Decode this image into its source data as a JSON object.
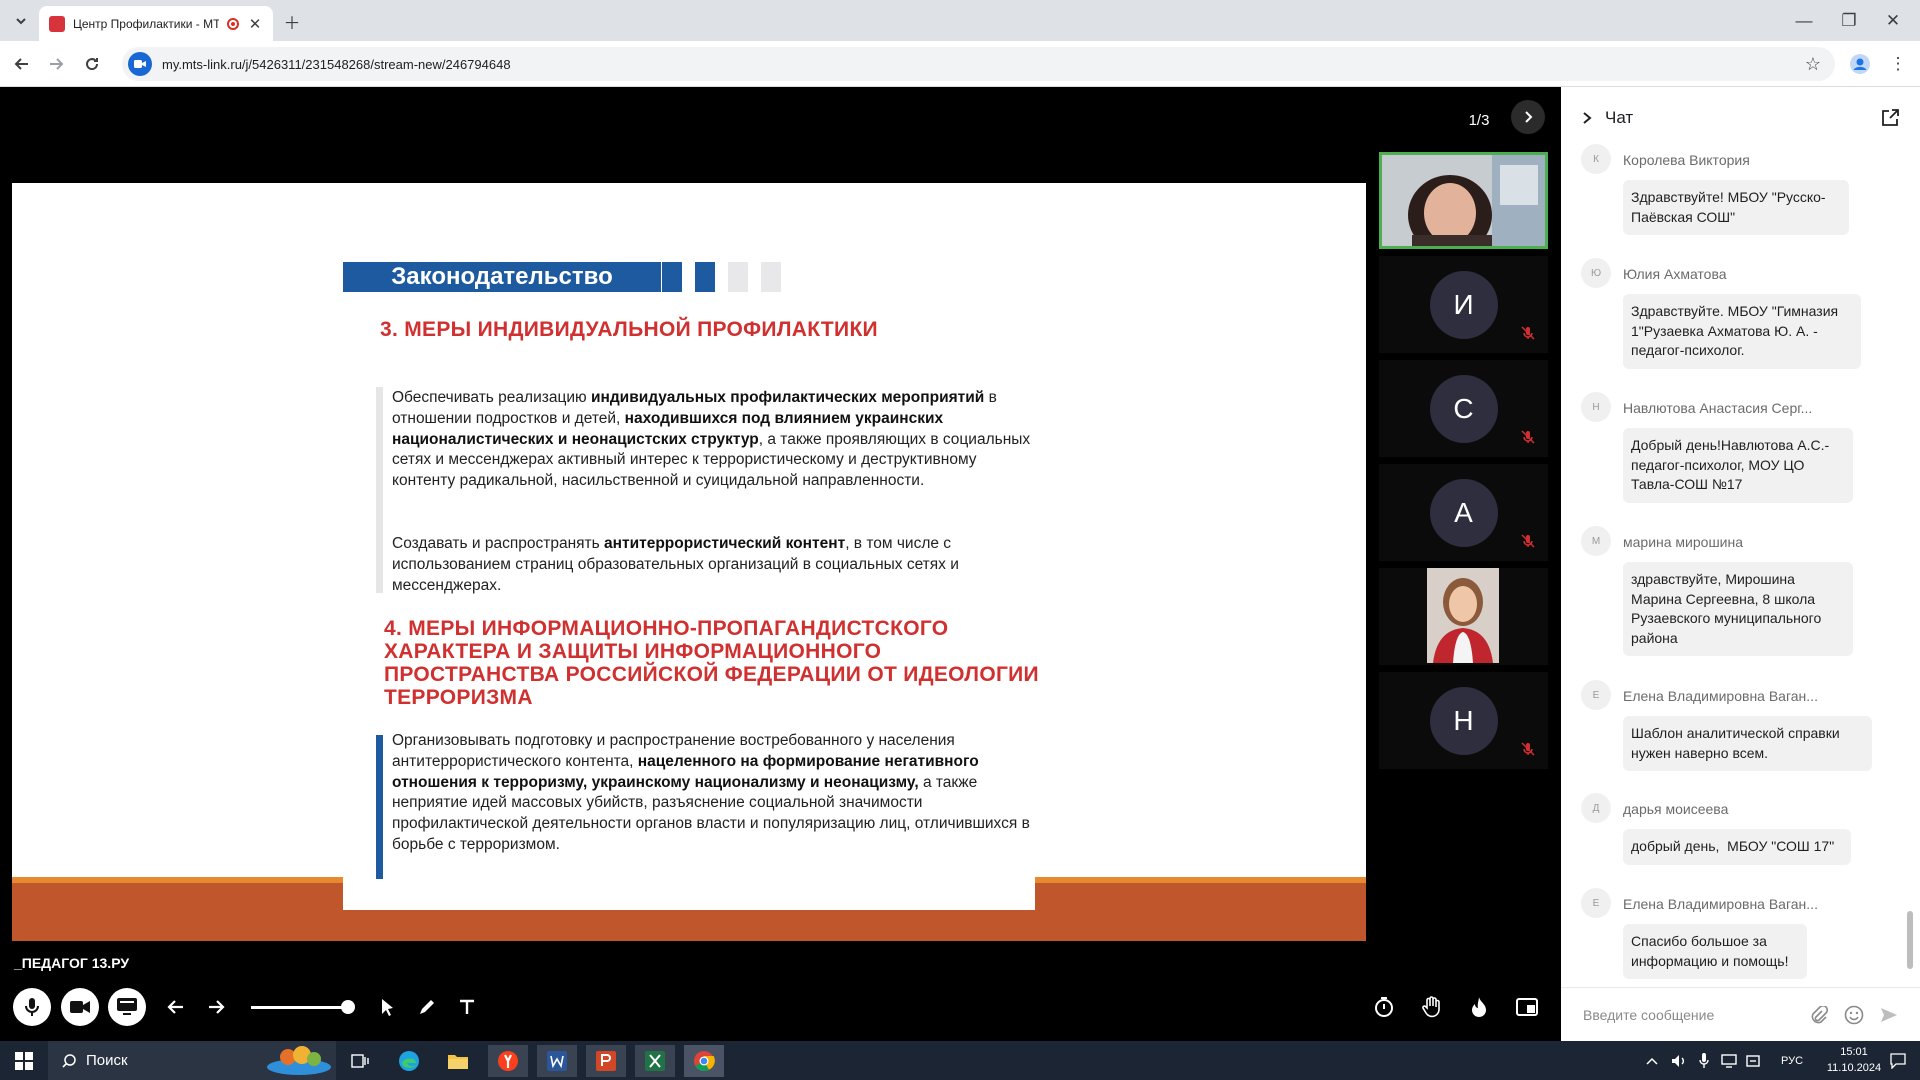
{
  "browser": {
    "tab_title": "Центр Профилактики - МТ",
    "url": "my.mts-link.ru/j/5426311/231548268/stream-new/246794648"
  },
  "stage": {
    "pager": "1/3",
    "brand": "_ПЕДАГОГ 13.РУ"
  },
  "slide": {
    "header": "Законодательство",
    "section3_title": "3. МЕРЫ ИНДИВИДУАЛЬНОЙ ПРОФИЛАКТИКИ",
    "section3_para1": [
      {
        "text": "Обеспечивать реализацию ",
        "bold": false
      },
      {
        "text": "индивидуальных профилактических мероприятий",
        "bold": true
      },
      {
        "text": " в отношении подростков и детей, ",
        "bold": false
      },
      {
        "text": "находившихся под влиянием украинских националистических и неонацистских структур",
        "bold": true
      },
      {
        "text": ", а также проявляющих в социальных сетях и мессенджерах активный интерес к террористическому и деструктивному контенту радикальной, насильственной и суицидальной направленности.",
        "bold": false
      }
    ],
    "section3_para2": [
      {
        "text": "Создавать и распространять ",
        "bold": false
      },
      {
        "text": "антитеррористический контент",
        "bold": true
      },
      {
        "text": ", в том числе с использованием страниц образовательных организаций в социальных сетях и мессенджерах.",
        "bold": false
      }
    ],
    "section4_title": "4. МЕРЫ ИНФОРМАЦИОННО-ПРОПАГАНДИСТСКОГО ХАРАКТЕРА И ЗАЩИТЫ ИНФОРМАЦИОННОГО ПРОСТРАНСТВА РОССИЙСКОЙ ФЕДЕРАЦИИ ОТ ИДЕОЛОГИИ ТЕРРОРИЗМА",
    "section4_para": [
      {
        "text": "Организовывать подготовку и распространение востребованного у населения антитеррористического контента, ",
        "bold": false
      },
      {
        "text": "нацеленного на формирование негативного отношения к терроризму, украинскому национализму и неонацизму,",
        "bold": true
      },
      {
        "text": " а также неприятие идей массовых убийств, разъяснение социальной значимости профилактической деятельности органов власти и популяризацию лиц, отличившихся в борьбе с терроризмом.",
        "bold": false
      }
    ]
  },
  "participants": [
    {
      "type": "video"
    },
    {
      "initial": "И",
      "muted": true
    },
    {
      "initial": "С",
      "muted": true
    },
    {
      "initial": "А",
      "muted": true
    },
    {
      "type": "video"
    },
    {
      "initial": "Н",
      "muted": true
    }
  ],
  "chat": {
    "title": "Чат",
    "input_placeholder": "Введите сообщение",
    "messages": [
      {
        "avatar": "К",
        "name": "Королева Виктория",
        "text": "Здравствуйте! МБОУ \"Русско-Паёвская СОШ\""
      },
      {
        "avatar": "Ю",
        "name": "Юлия Ахматова",
        "text": "Здравствуйте. МБОУ \"Гимназия 1\"Рузаевка Ахматова Ю. А. - педагог-психолог."
      },
      {
        "avatar": "Н",
        "name": "Навлютова Анастасия Серг...",
        "text": "Добрый день!Навлютова А.С.- педагог-психолог, МОУ ЦО Тавла-СОШ №17"
      },
      {
        "avatar": "М",
        "name": "марина мирошина",
        "text": "здравствуйте, Мирошина Марина Сергеевна, 8 школа Рузаевского муниципального района"
      },
      {
        "avatar": "Е",
        "name": "Елена Владимировна Ваган...",
        "text": "Шаблон аналитической справки нужен наверно всем."
      },
      {
        "avatar": "Д",
        "name": "дарья моисеева",
        "text": "добрый день,  МБОУ \"СОШ 17\""
      },
      {
        "avatar": "Е",
        "name": "Елена Владимировна Ваган...",
        "text": "Спасибо большое за информацию и помощь!"
      }
    ]
  },
  "taskbar": {
    "search_label": "Поиск",
    "lang": "РУС",
    "time": "15:01",
    "date": "11.10.2024"
  },
  "colors": {
    "slide_header_blue": "#1e5aa0",
    "slide_red": "#d0302f",
    "slide_orange_band": "#c0562b",
    "active_speaker_border": "#4caf50"
  }
}
